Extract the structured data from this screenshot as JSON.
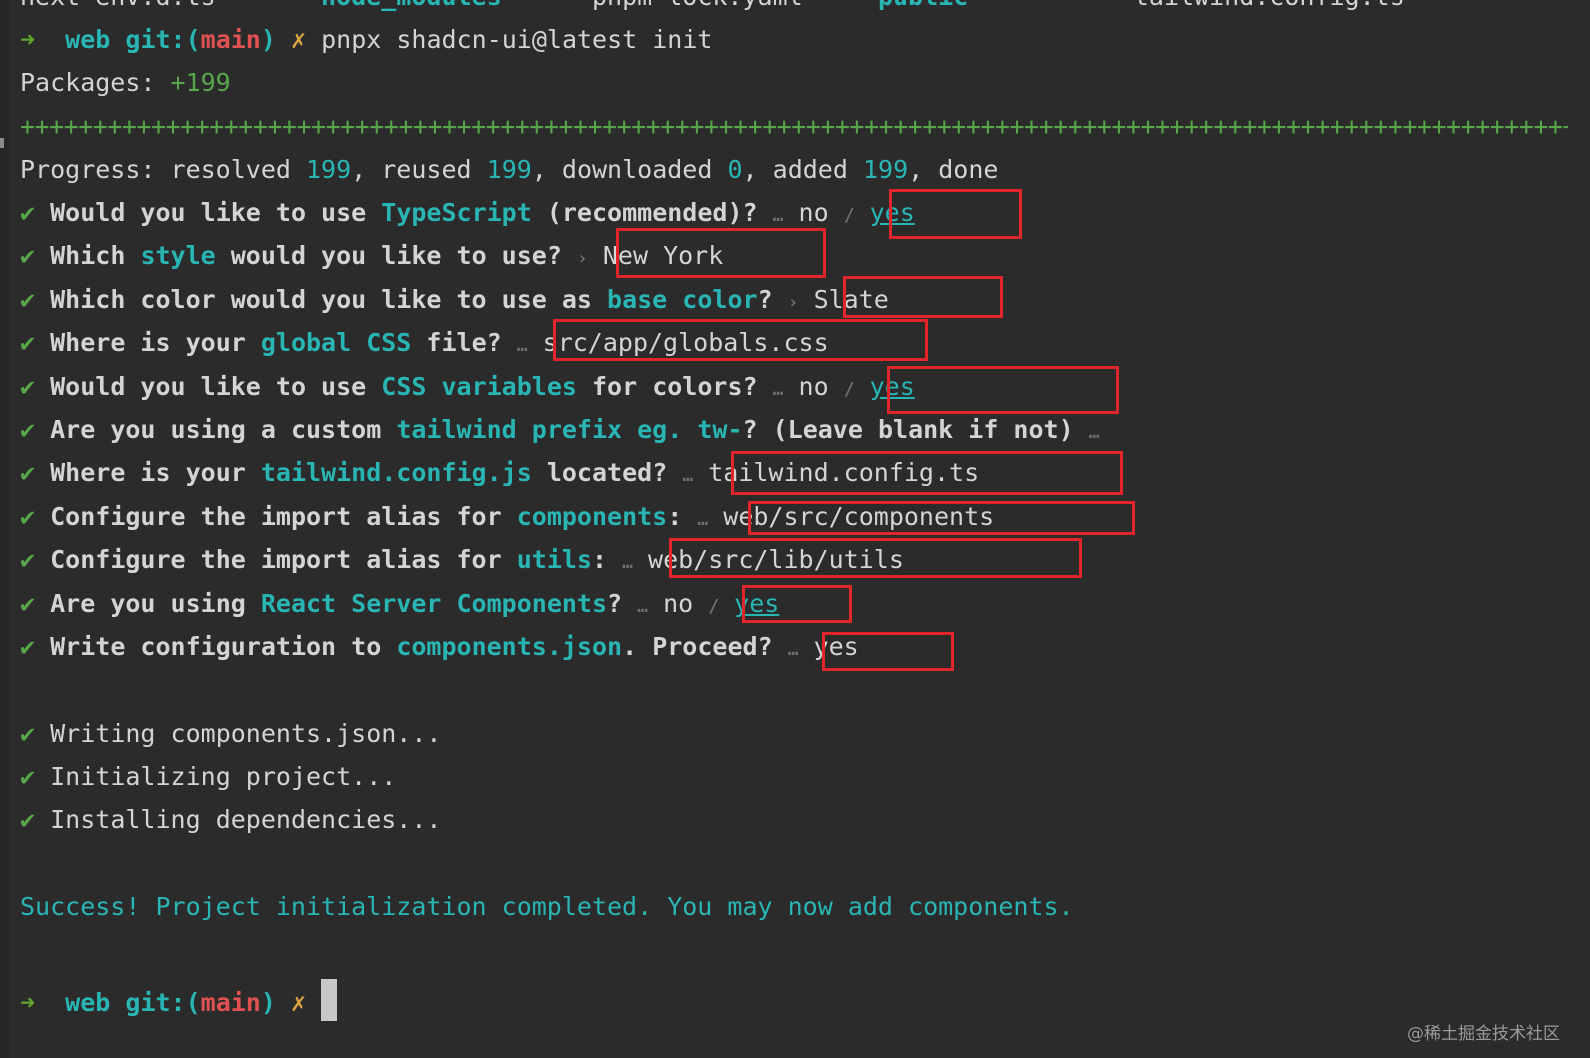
{
  "top_listing": {
    "items": [
      "next-env.d.ts",
      "node_modules",
      "pnpm-lock.yaml",
      "public",
      "tailwind.config.ts"
    ]
  },
  "prompt": {
    "arrow": "➜",
    "dir": "web",
    "git_label": "git:(",
    "branch": "main",
    "git_close": ")",
    "dirty": "✗"
  },
  "command": "pnpx shadcn-ui@latest init",
  "packages": {
    "label": "Packages:",
    "value": "+199"
  },
  "plus_bar": "+++++++++++++++++++++++++++++++++++++++++++++++++++++++++++++++++++++++++++++++++++++++++++++++++++++++++++++++++++++++++++++",
  "progress": {
    "label": "Progress: resolved",
    "resolved": "199",
    "reused_label": ", reused",
    "reused": "199",
    "downloaded_label": ", downloaded",
    "downloaded": "0",
    "added_label": ", added",
    "added": "199",
    "done_label": ", done"
  },
  "check": "✔",
  "ellipsis": "…",
  "chevron": "›",
  "slash": "/",
  "questions": {
    "q1": {
      "a": "Would you like to use ",
      "h": "TypeScript",
      "b": " (recommended)?",
      "no": "no",
      "yes": "yes"
    },
    "q2": {
      "a": "Which ",
      "h": "style",
      "b": " would you like to use?",
      "answer": "New York"
    },
    "q3": {
      "a": "Which color would you like to use as ",
      "h": "base color",
      "b": "?",
      "answer": "Slate"
    },
    "q4": {
      "a": "Where is your ",
      "h": "global CSS",
      "b": " file?",
      "answer": "src/app/globals.css"
    },
    "q5": {
      "a": "Would you like to use ",
      "h": "CSS variables",
      "b": " for colors?",
      "no": "no",
      "yes": "yes"
    },
    "q6": {
      "a": "Are you using a custom ",
      "h": "tailwind prefix eg. tw-",
      "b": "? (Leave blank if not)"
    },
    "q7": {
      "a": "Where is your ",
      "h": "tailwind.config.js",
      "b": " located?",
      "answer": "tailwind.config.ts"
    },
    "q8": {
      "a": "Configure the import alias for ",
      "h": "components",
      "b": ":",
      "answer": "web/src/components"
    },
    "q9": {
      "a": "Configure the import alias for ",
      "h": "utils",
      "b": ":",
      "answer": "web/src/lib/utils"
    },
    "q10": {
      "a": "Are you using ",
      "h": "React Server Components",
      "b": "?",
      "no": "no",
      "yes": "yes"
    },
    "q11": {
      "a": "Write configuration to ",
      "h": "components.json",
      "b": ". Proceed?",
      "answer": "yes"
    }
  },
  "steps": [
    "Writing components.json...",
    "Initializing project...",
    "Installing dependencies..."
  ],
  "success": "Success! Project initialization completed. You may now add components.",
  "watermark": "@稀土掘金技术社区",
  "colors": {
    "background": "#2b2b2b",
    "cyan": "#2ab5b5",
    "green": "#57a64a",
    "branch_red": "#e05252",
    "dirty_yellow": "#d9a441",
    "highlight_box": "#e0262b"
  }
}
